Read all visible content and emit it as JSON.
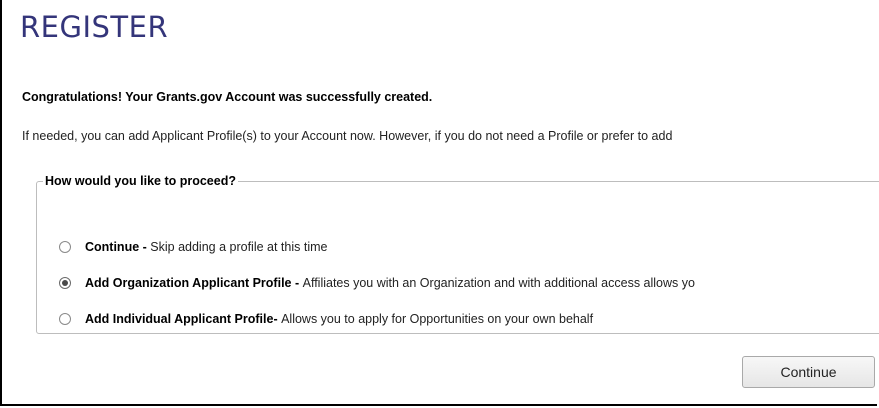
{
  "page": {
    "title": "REGISTER"
  },
  "message": {
    "congrats": "Congratulations! Your Grants.gov Account was successfully created.",
    "info": "If needed, you can add Applicant Profile(s) to your Account now. However, if you do not need a Profile or prefer to add"
  },
  "proceed": {
    "legend": "How would you like to proceed?",
    "options": [
      {
        "label": "Continue",
        "separator": " - ",
        "description": "Skip adding a profile at this time",
        "selected": false
      },
      {
        "label": "Add Organization Applicant Profile",
        "separator": " - ",
        "description": "Affiliates you with an Organization and with additional access allows yo",
        "selected": true
      },
      {
        "label": "Add Individual Applicant Profile",
        "separator": "- ",
        "description": "Allows you to apply for Opportunities on your own behalf",
        "selected": false
      }
    ]
  },
  "actions": {
    "continue_label": "Continue"
  }
}
